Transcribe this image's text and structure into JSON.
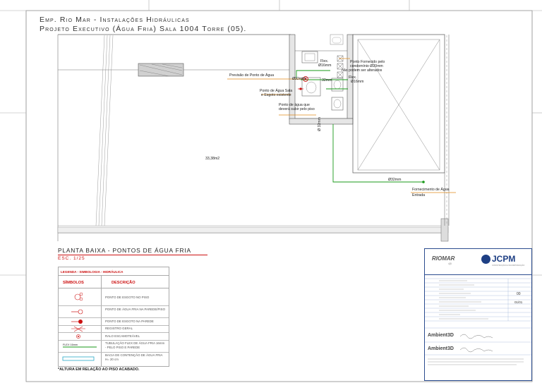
{
  "header": {
    "line1": "Emp. Rio Mar - Instalações Hidráulicas",
    "line2": "Projeto Executivo (Água Fria) Sala 1004 Torre (05)."
  },
  "plan": {
    "area": "33,38m2",
    "notes": {
      "flex": "Flex.",
      "flex_dim": "Ø16mm",
      "supply_note_1": "Ponto Fornecido pelo",
      "supply_note_2": "condomínio Ø20mm",
      "supply_note_3": "não podem ser alterados",
      "flex_dim2": "Flex.",
      "flex_dim3": "Ø16mm",
      "prev_ponto": "Previsão de Ponto de Água",
      "pipe_20": "Ø32mm",
      "pipe_20b": "32mm",
      "ponto_agua_1": "Ponto de Água Sala",
      "ponto_agua_2": "e Esgoto existente",
      "subir_1": "Ponto de água que",
      "subir_2": "deverá subir pelo piso",
      "vert_pipe": "Ø 32mm",
      "horiz_pipe": "Ø32mm",
      "fornec_1": "Fornecimento de Água",
      "fornec_2": "Entrada"
    },
    "caption": "PLANTA BAIXA - PONTOS  DE ÁGUA FRIA",
    "scale": "ESC. 1/25"
  },
  "legend": {
    "title": "LEGENDA - SIMBOLOGIA - HIDRÁULICA",
    "col_symbols": "SÍMBOLOS",
    "col_desc": "DESCRIÇÃO",
    "rows": [
      {
        "desc": "PONTO DE ESGOTO NO PISO"
      },
      {
        "desc": "PONTO DE ÁGUA FRIA NA PAREDE/PISO"
      },
      {
        "desc": "PONTO DE ESGOTO NA PAREDE"
      },
      {
        "desc": "REGISTRO  GERAL"
      },
      {
        "desc": "RALO ESCAMOTEÁVEL"
      },
      {
        "desc": "TUBULAÇÃO FLEX DE ÁGUA FRIA 16mm - PELO PISO E PAREDE",
        "symbol_label": "FLEX 16mm"
      },
      {
        "desc": "BACIA DE CONTENÇÃO DE ÁGUA FRIA H= 20 cm"
      }
    ],
    "footnote": "*ALTURA EM RELAÇÃO AO PISO ACABADO."
  },
  "titleblock": {
    "brand1": "RIOMAR",
    "brand1_sub": "4|5",
    "brand2": "JCPM",
    "brand2_sub": "CONSTRUÇÃO E INCORPORAÇÃO",
    "ambient1": "Ambient3D",
    "ambient2": "Ambient3D",
    "revision": "00",
    "sheet": "01/01"
  },
  "colors": {
    "green": "#1a9a1a",
    "orange": "#e08a1a",
    "red": "#cc1111",
    "cyan": "#29a9c7",
    "titleblock_blue": "#2b4c8f"
  }
}
